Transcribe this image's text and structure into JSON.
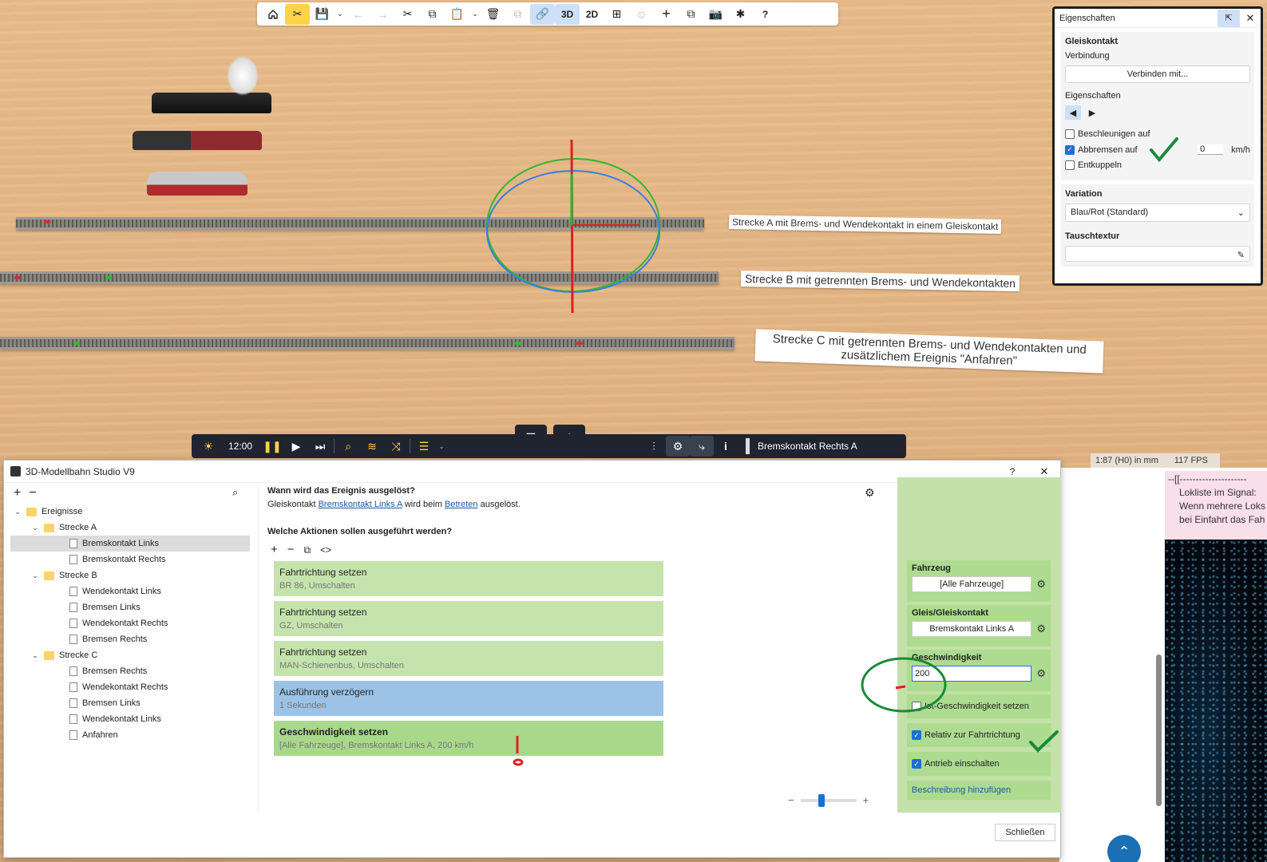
{
  "toolbar": {
    "icons": [
      "home-icon",
      "tools-icon",
      "save-icon",
      "chevron-down-icon",
      "undo-icon",
      "redo-icon",
      "cut-icon",
      "copy-icon",
      "paste-icon",
      "chevron-down-icon",
      "delete-icon",
      "duplicate-icon",
      "link-icon",
      "grid-icon",
      "person-icon",
      "add-icon",
      "window-icon",
      "camera-icon",
      "plugin-icon",
      "help-icon"
    ],
    "view_3d": "3D",
    "view_2d": "2D",
    "help": "?"
  },
  "scene": {
    "label_a": "Strecke A mit Brems- und Wendekontakt in einem Gleiskontakt",
    "label_b": "Strecke B mit getrennten Brems- und Wendekontakten",
    "label_c": "Strecke C mit getrennten Brems- und Wendekontakten und zusätzlichem Ereignis \"Anfahren\""
  },
  "properties": {
    "title": "Eigenschaften",
    "section": "Gleiskontakt",
    "connection_label": "Verbindung",
    "connect_button": "Verbinden mit...",
    "props_label": "Eigenschaften",
    "accelerate": {
      "label": "Beschleunigen auf",
      "checked": false
    },
    "brake": {
      "label": "Abbremsen auf",
      "checked": true,
      "value": "0",
      "unit": "km/h"
    },
    "uncouple": {
      "label": "Entkuppeln",
      "checked": false
    },
    "variation_label": "Variation",
    "variation_value": "Blau/Rot (Standard)",
    "texture_label": "Tauschtextur"
  },
  "bottombar": {
    "time": "12:00",
    "selection": "Bremskontakt Rechts A"
  },
  "status": {
    "scale": "1:87 (H0) in mm",
    "fps": "117 FPS"
  },
  "note": {
    "line0": "--[[---------------------",
    "line1": "Lokliste im Signal:",
    "line2": "Wenn mehrere Loks",
    "line3": "bei Einfahrt das Fah"
  },
  "dialog": {
    "title": "3D-Modellbahn Studio V9",
    "help": "?",
    "close": "✕",
    "tree": [
      {
        "label": "Ereignisse",
        "type": "folder",
        "level": 0
      },
      {
        "label": "Strecke A",
        "type": "folder",
        "level": 1
      },
      {
        "label": "Bremskontakt Links",
        "type": "doc",
        "level": 2,
        "selected": true
      },
      {
        "label": "Bremskontakt Rechts",
        "type": "doc",
        "level": 2
      },
      {
        "label": "Strecke B",
        "type": "folder",
        "level": 1
      },
      {
        "label": "Wendekontakt Links",
        "type": "doc",
        "level": 2
      },
      {
        "label": "Bremsen Links",
        "type": "doc",
        "level": 2
      },
      {
        "label": "Wendekontakt Rechts",
        "type": "doc",
        "level": 2
      },
      {
        "label": "Bremsen Rechts",
        "type": "doc",
        "level": 2
      },
      {
        "label": "Strecke C",
        "type": "folder",
        "level": 1
      },
      {
        "label": "Bremsen Rechts",
        "type": "doc",
        "level": 2
      },
      {
        "label": "Wendekontakt Rechts",
        "type": "doc",
        "level": 2
      },
      {
        "label": "Bremsen Links",
        "type": "doc",
        "level": 2
      },
      {
        "label": "Wendekontakt Links",
        "type": "doc",
        "level": 2
      },
      {
        "label": "Anfahren",
        "type": "doc",
        "level": 2
      }
    ],
    "trigger_heading": "Wann wird das Ereignis ausgelöst?",
    "trigger_pre": "Gleiskontakt ",
    "trigger_link1": "Bremskontakt Links A",
    "trigger_mid": " wird beim ",
    "trigger_link2": "Betreten",
    "trigger_post": " ausgelöst.",
    "actions_heading": "Welche Aktionen sollen ausgeführt werden?",
    "actions": [
      {
        "title": "Fahrtrichtung setzen",
        "sub": "BR 86, Umschalten",
        "style": "green"
      },
      {
        "title": "Fahrtrichtung setzen",
        "sub": "GZ, Umschalten",
        "style": "green"
      },
      {
        "title": "Fahrtrichtung setzen",
        "sub": "MAN-Schienenbus, Umschalten",
        "style": "green"
      },
      {
        "title": "Ausführung verzögern",
        "sub": "1 Sekunden",
        "style": "blue"
      },
      {
        "title": "Geschwindigkeit setzen",
        "sub": "[Alle Fahrzeuge], Bremskontakt Links A, 200 km/h",
        "style": "green2"
      }
    ],
    "right": {
      "vehicle_label": "Fahrzeug",
      "vehicle_value": "[Alle Fahrzeuge]",
      "track_label": "Gleis/Gleiskontakt",
      "track_value": "Bremskontakt Links A",
      "speed_label": "Geschwindigkeit",
      "speed_value": "200",
      "actual_speed": {
        "label": "Ist-Geschwindigkeit setzen",
        "checked": false
      },
      "relative": {
        "label": "Relativ zur Fahrtrichtung",
        "checked": true
      },
      "drive_on": {
        "label": "Antrieb einschalten",
        "checked": true
      },
      "add_description": "Beschreibung hinzufügen"
    },
    "close_button": "Schließen"
  }
}
